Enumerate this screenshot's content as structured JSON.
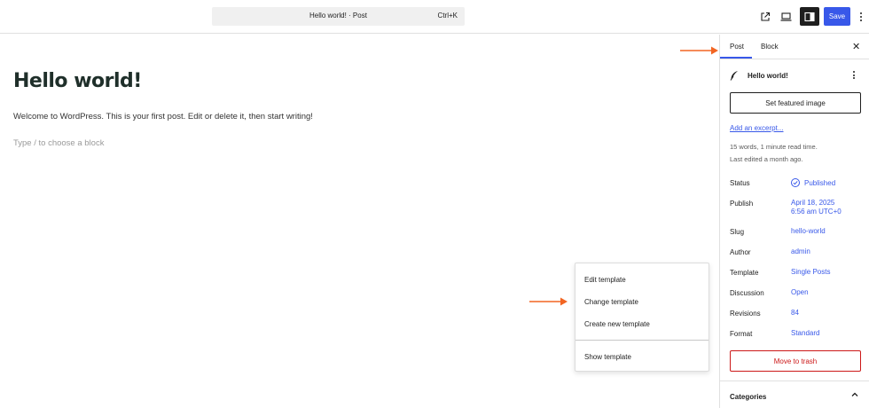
{
  "topbar": {
    "command_title": "Hello world! · Post",
    "command_shortcut": "Ctrl+K",
    "save_label": "Save",
    "icons": [
      "external-link-icon",
      "device-preview-icon",
      "sidebar-toggle-icon",
      "options-icon"
    ]
  },
  "editor": {
    "title": "Hello world!",
    "paragraph": "Welcome to WordPress. This is your first post. Edit or delete it, then start writing!",
    "placeholder": "Type / to choose a block"
  },
  "template_menu": {
    "items": [
      "Edit template",
      "Change template",
      "Create new template"
    ],
    "show_template": "Show template"
  },
  "sidebar": {
    "tabs": [
      "Post",
      "Block"
    ],
    "active_tab": "Post",
    "post_title": "Hello world!",
    "featured_image_label": "Set featured image",
    "excerpt_link": "Add an excerpt...",
    "meta_line1": "15 words, 1 minute read time.",
    "meta_line2": "Last edited a month ago.",
    "rows": {
      "status": {
        "label": "Status",
        "value": "Published"
      },
      "publish": {
        "label": "Publish",
        "value_line1": "April 18, 2025",
        "value_line2": "6:56 am UTC+0"
      },
      "slug": {
        "label": "Slug",
        "value": "hello-world"
      },
      "author": {
        "label": "Author",
        "value": "admin"
      },
      "template": {
        "label": "Template",
        "value": "Single Posts"
      },
      "discussion": {
        "label": "Discussion",
        "value": "Open"
      },
      "revisions": {
        "label": "Revisions",
        "value": "84"
      },
      "format": {
        "label": "Format",
        "value": "Standard"
      }
    },
    "trash_label": "Move to trash",
    "categories_label": "Categories"
  },
  "colors": {
    "accent": "#3858e9",
    "danger": "#cc1818",
    "annotation_arrow": "#f26522",
    "text": "#1e1e1e"
  }
}
